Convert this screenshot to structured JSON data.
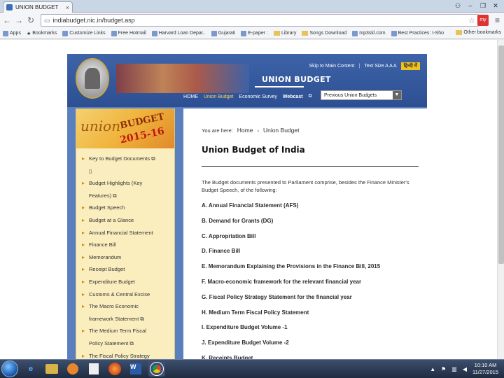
{
  "browser": {
    "tab_title": "UNION BUDGET",
    "tab_close": "×",
    "url": "indiabudget.nic.in/budget.asp",
    "bookmarks": [
      "Apps",
      "Bookmarks",
      "Customize Links",
      "Free Hotmail",
      "Harvard Loan Depar..",
      "Gujarati",
      "E-paper :",
      "Library",
      "Songs Download",
      "mp3skl.com",
      "Best Practices: I-Sho"
    ],
    "other_bookmarks": "Other bookmarks",
    "extension_label": "my"
  },
  "site": {
    "top_links": {
      "skip": "Skip to Main Content",
      "text_size": "Text Size A A A",
      "hindi": "हिन्दी में"
    },
    "title": "UNION BUDGET",
    "nav": {
      "home": "HOME",
      "union_budget": "Union Budget",
      "economic_survey": "Economic Survey",
      "webcast": "Webcast"
    },
    "dropdown": {
      "selected": "Previous Union Budgets"
    },
    "sidebar_banner": {
      "union": "union",
      "budget": "BUDGET",
      "year": "2015-16"
    },
    "sidebar_items": [
      "Key to Budget Documents",
      "",
      "Budget Highlights (Key",
      "Features)",
      "Budget Speech",
      "Budget at a Glance",
      "Annual Financial Statement",
      "Finance Bill",
      "Memorandum",
      "Receipt Budget",
      "Expenditure Budget",
      "Customs & Central Excise",
      "The Macro Economic",
      "framework Statement",
      "The Medium Term Fiscal",
      "Policy Statement",
      "The Fiscal Policy Strategy"
    ],
    "breadcrumb": {
      "prefix": "You are here:",
      "home": "Home",
      "arrow": "›",
      "current": "Union Budget"
    },
    "page_title": "Union Budget of India",
    "intro": "The Budget documents presented to Parliament comprise, besides the Finance Minister's Budget Speech, of the following:",
    "documents": [
      "A. Annual Financial Statement (AFS)",
      "B. Demand for Grants (DG)",
      "C. Appropriation Bill",
      "D. Finance Bill",
      "E. Memorandum Explaining the Provisions in the Finance Bill, 2015",
      "F. Macro-economic framework for the relevant financial year",
      "G. Fiscal Policy Strategy Statement for the financial year",
      "H. Medium Term Fiscal Policy Statement",
      "I. Expenditure Budget Volume -1",
      "J. Expenditure Budget Volume -2",
      "K. Receipts Budget"
    ]
  },
  "taskbar": {
    "word_label": "W",
    "time": "10:10 AM",
    "date": "11/27/2015"
  }
}
